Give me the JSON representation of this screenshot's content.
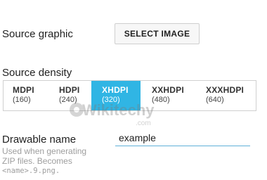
{
  "source_graphic": {
    "label": "Source graphic",
    "button_label": "SELECT IMAGE"
  },
  "source_density": {
    "label": "Source density",
    "selected": "XHDPI",
    "options": [
      {
        "name": "MDPI",
        "dpi": "(160)"
      },
      {
        "name": "HDPI",
        "dpi": "(240)"
      },
      {
        "name": "XHDPI",
        "dpi": "(320)"
      },
      {
        "name": "XXHDPI",
        "dpi": "(480)"
      },
      {
        "name": "XXXHDPI",
        "dpi": "(640)"
      }
    ]
  },
  "drawable_name": {
    "label": "Drawable name",
    "value": "example",
    "help_text": "Used when generating ZIP files. Becomes",
    "help_code": "<name>.9.png."
  },
  "watermark": {
    "text": "Wikitechy",
    "subtext": ".com"
  },
  "colors": {
    "accent": "#30b5e4",
    "input_underline": "#5fb0d8",
    "help_text": "#9e9e9e"
  }
}
